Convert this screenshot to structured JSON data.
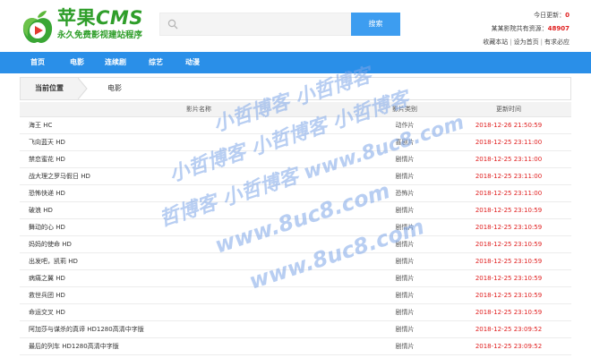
{
  "logo": {
    "title_main": "苹果",
    "title_cms": "CMS",
    "subtitle": "永久免费影视建站程序"
  },
  "search": {
    "placeholder": "",
    "button_label": "搜索"
  },
  "stats": {
    "today_label": "今日更新：",
    "today_value": "0",
    "total_label": "某某影院共有资源：",
    "total_value": "48907",
    "links": [
      "收藏本站",
      "设为首页",
      "有求必应"
    ]
  },
  "nav": {
    "items": [
      "首页",
      "电影",
      "连续剧",
      "综艺",
      "动漫"
    ]
  },
  "breadcrumb": {
    "current_label": "当前位置",
    "item": "电影"
  },
  "table": {
    "headers": [
      "影片名称",
      "影片类别",
      "更新时间"
    ],
    "rows": [
      {
        "name": "海王 HC",
        "type": "动作片",
        "time": "2018-12-26 21:50:59"
      },
      {
        "name": "飞向蓝天 HD",
        "type": "喜剧片",
        "time": "2018-12-25 23:11:00"
      },
      {
        "name": "禁恋蜜花 HD",
        "type": "剧情片",
        "time": "2018-12-25 23:11:00"
      },
      {
        "name": "战大理之罗马假日 HD",
        "type": "剧情片",
        "time": "2018-12-25 23:11:00"
      },
      {
        "name": "恐怖快递 HD",
        "type": "恐怖片",
        "time": "2018-12-25 23:11:00"
      },
      {
        "name": "破浪 HD",
        "type": "剧情片",
        "time": "2018-12-25 23:10:59"
      },
      {
        "name": "舞动的心 HD",
        "type": "剧情片",
        "time": "2018-12-25 23:10:59"
      },
      {
        "name": "妈妈的使命 HD",
        "type": "剧情片",
        "time": "2018-12-25 23:10:59"
      },
      {
        "name": "出发吧，凯莉 HD",
        "type": "剧情片",
        "time": "2018-12-25 23:10:59"
      },
      {
        "name": "病痛之翼 HD",
        "type": "剧情片",
        "time": "2018-12-25 23:10:59"
      },
      {
        "name": "救世兵团 HD",
        "type": "剧情片",
        "time": "2018-12-25 23:10:59"
      },
      {
        "name": "命运交叉 HD",
        "type": "剧情片",
        "time": "2018-12-25 23:10:59"
      },
      {
        "name": "阿加莎与谋杀的真谛 HD1280高清中字版",
        "type": "剧情片",
        "time": "2018-12-25 23:09:52"
      },
      {
        "name": "最后的列车 HD1280高清中字版",
        "type": "剧情片",
        "time": "2018-12-25 23:09:52"
      }
    ]
  },
  "watermark": {
    "lines": [
      "小哲博客 小哲博客",
      "小哲博客 小哲博客 小哲博客",
      "哲博客 小哲博客 www.8uc8.com",
      "www.8uc8.com",
      "www.8uc8.com"
    ]
  },
  "colors": {
    "brand_green": "#2f9e2a",
    "nav_blue": "#2a8fe8",
    "button_blue": "#3d9df0",
    "time_red": "#e02020",
    "watermark_blue": "#7ea6e8"
  }
}
